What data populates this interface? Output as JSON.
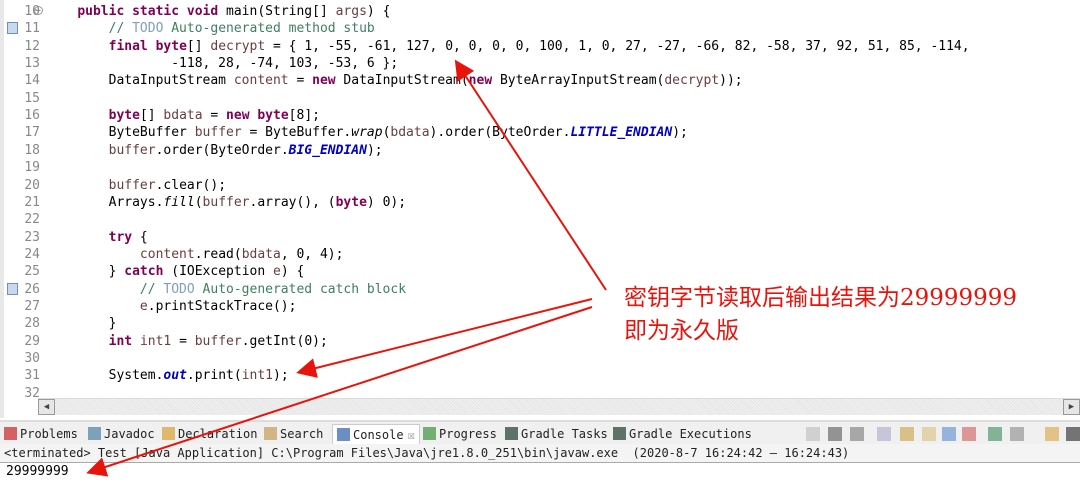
{
  "editor": {
    "lines": [
      {
        "n": "10",
        "tokens": [
          [
            "    ",
            ""
          ],
          [
            "public static void ",
            "kw"
          ],
          [
            "main(String[] ",
            ""
          ],
          [
            "args",
            "var"
          ],
          [
            ") {",
            ""
          ]
        ]
      },
      {
        "n": "11",
        "tokens": [
          [
            "        // ",
            "cm"
          ],
          [
            "TODO",
            "todo"
          ],
          [
            " Auto-generated method stub",
            "cm"
          ]
        ]
      },
      {
        "n": "12",
        "tokens": [
          [
            "        ",
            ""
          ],
          [
            "final byte",
            "kw"
          ],
          [
            "[] ",
            ""
          ],
          [
            "decrypt",
            "var"
          ],
          [
            " = { 1, -55, -61, 127, 0, 0, 0, 0, 100, 1, 0, 27, -27, -66, 82, -58, 37, 92, 51, 85, -114,",
            ""
          ]
        ]
      },
      {
        "n": "13",
        "tokens": [
          [
            "                -118, 28, -74, 103, -53, 6 };",
            ""
          ]
        ]
      },
      {
        "n": "14",
        "tokens": [
          [
            "        DataInputStream ",
            ""
          ],
          [
            "content",
            "var"
          ],
          [
            " = ",
            ""
          ],
          [
            "new",
            "kw"
          ],
          [
            " DataInputStream(",
            ""
          ],
          [
            "new",
            "kw"
          ],
          [
            " ByteArrayInputStream(",
            ""
          ],
          [
            "decrypt",
            "var"
          ],
          [
            "));",
            ""
          ]
        ]
      },
      {
        "n": "15",
        "tokens": []
      },
      {
        "n": "16",
        "tokens": [
          [
            "        ",
            ""
          ],
          [
            "byte",
            "kw"
          ],
          [
            "[] ",
            ""
          ],
          [
            "bdata",
            "var"
          ],
          [
            " = ",
            ""
          ],
          [
            "new byte",
            "kw"
          ],
          [
            "[8];",
            ""
          ]
        ]
      },
      {
        "n": "17",
        "tokens": [
          [
            "        ByteBuffer ",
            ""
          ],
          [
            "buffer",
            "var"
          ],
          [
            " = ByteBuffer.",
            ""
          ],
          [
            "wrap",
            "it"
          ],
          [
            "(",
            ""
          ],
          [
            "bdata",
            "var"
          ],
          [
            ").order(ByteOrder.",
            ""
          ],
          [
            "LITTLE_ENDIAN",
            "st"
          ],
          [
            ");",
            ""
          ]
        ]
      },
      {
        "n": "18",
        "tokens": [
          [
            "        ",
            ""
          ],
          [
            "buffer",
            "var"
          ],
          [
            ".order(ByteOrder.",
            ""
          ],
          [
            "BIG_ENDIAN",
            "st"
          ],
          [
            ");",
            ""
          ]
        ]
      },
      {
        "n": "19",
        "tokens": []
      },
      {
        "n": "20",
        "tokens": [
          [
            "        ",
            ""
          ],
          [
            "buffer",
            "var"
          ],
          [
            ".clear();",
            ""
          ]
        ]
      },
      {
        "n": "21",
        "tokens": [
          [
            "        Arrays.",
            ""
          ],
          [
            "fill",
            "it"
          ],
          [
            "(",
            ""
          ],
          [
            "buffer",
            "var"
          ],
          [
            ".array(), (",
            ""
          ],
          [
            "byte",
            "kw"
          ],
          [
            ") 0);",
            ""
          ]
        ]
      },
      {
        "n": "22",
        "tokens": []
      },
      {
        "n": "23",
        "tokens": [
          [
            "        ",
            ""
          ],
          [
            "try",
            "kw"
          ],
          [
            " {",
            ""
          ]
        ]
      },
      {
        "n": "24",
        "tokens": [
          [
            "            ",
            ""
          ],
          [
            "content",
            "var"
          ],
          [
            ".read(",
            ""
          ],
          [
            "bdata",
            "var"
          ],
          [
            ", 0, 4);",
            ""
          ]
        ]
      },
      {
        "n": "25",
        "tokens": [
          [
            "        } ",
            ""
          ],
          [
            "catch",
            "kw"
          ],
          [
            " (IOException ",
            ""
          ],
          [
            "e",
            "var"
          ],
          [
            ") {",
            ""
          ]
        ]
      },
      {
        "n": "26",
        "tokens": [
          [
            "            // ",
            "cm"
          ],
          [
            "TODO",
            "todo"
          ],
          [
            " Auto-generated catch block",
            "cm"
          ]
        ]
      },
      {
        "n": "27",
        "tokens": [
          [
            "            ",
            ""
          ],
          [
            "e",
            "var"
          ],
          [
            ".printStackTrace();",
            ""
          ]
        ]
      },
      {
        "n": "28",
        "tokens": [
          [
            "        }",
            ""
          ]
        ]
      },
      {
        "n": "29",
        "tokens": [
          [
            "        ",
            ""
          ],
          [
            "int",
            "kw"
          ],
          [
            " ",
            ""
          ],
          [
            "int1",
            "var"
          ],
          [
            " = ",
            ""
          ],
          [
            "buffer",
            "var"
          ],
          [
            ".getInt(0);",
            ""
          ]
        ]
      },
      {
        "n": "30",
        "tokens": []
      },
      {
        "n": "31",
        "tokens": [
          [
            "        System.",
            ""
          ],
          [
            "out",
            "st"
          ],
          [
            ".print(",
            ""
          ],
          [
            "int1",
            "var"
          ],
          [
            ");",
            ""
          ]
        ]
      },
      {
        "n": "32",
        "tokens": []
      }
    ]
  },
  "tabs": [
    {
      "label": "Problems",
      "icon": "problems-icon"
    },
    {
      "label": "Javadoc",
      "icon": "javadoc-icon"
    },
    {
      "label": "Declaration",
      "icon": "declaration-icon"
    },
    {
      "label": "Search",
      "icon": "search-icon"
    },
    {
      "label": "Console",
      "icon": "console-icon",
      "close": "☒"
    },
    {
      "label": "Progress",
      "icon": "progress-icon"
    },
    {
      "label": "Gradle Tasks",
      "icon": "gradle-icon"
    },
    {
      "label": "Gradle Executions",
      "icon": "gradle-icon"
    }
  ],
  "console": {
    "header": "<terminated> Test [Java Application] C:\\Program Files\\Java\\jre1.8.0_251\\bin\\javaw.exe  (2020-8-7 16:24:42 – 16:24:43)",
    "output": "29999999"
  },
  "annotation": {
    "line1": "密钥字节读取后输出结果为29999999",
    "line2": "即为永久版",
    "color": "#e8140c"
  }
}
